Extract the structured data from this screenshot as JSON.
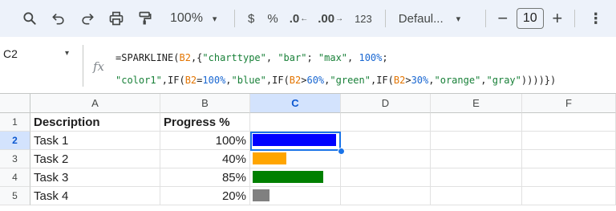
{
  "toolbar": {
    "zoom": "100%",
    "currency": "$",
    "percent": "%",
    "decrease_decimal": ".0",
    "increase_decimal": ".00",
    "number_format": "123",
    "font": "Defaul...",
    "font_size": "10",
    "minus": "−",
    "plus": "+",
    "more": "⋮",
    "caret": "▾"
  },
  "formula_bar": {
    "name_box": "C2",
    "fx": "fx"
  },
  "columns": [
    "A",
    "B",
    "C",
    "D",
    "E",
    "F"
  ],
  "rows": [
    "1",
    "2",
    "3",
    "4",
    "5"
  ],
  "headers": {
    "description": "Description",
    "progress": "Progress %"
  },
  "tasks": [
    {
      "name": "Task 1",
      "progress_label": "100%",
      "progress": 1.0,
      "color": "blue"
    },
    {
      "name": "Task 2",
      "progress_label": "40%",
      "progress": 0.4,
      "color": "orange"
    },
    {
      "name": "Task 3",
      "progress_label": "85%",
      "progress": 0.85,
      "color": "green"
    },
    {
      "name": "Task 4",
      "progress_label": "20%",
      "progress": 0.2,
      "color": "gray"
    }
  ],
  "colors": {
    "blue": "#0000ff",
    "orange": "#ffa500",
    "green": "#008000",
    "gray": "#808080",
    "selection": "#1a73e8"
  },
  "selected_cell": "C2"
}
